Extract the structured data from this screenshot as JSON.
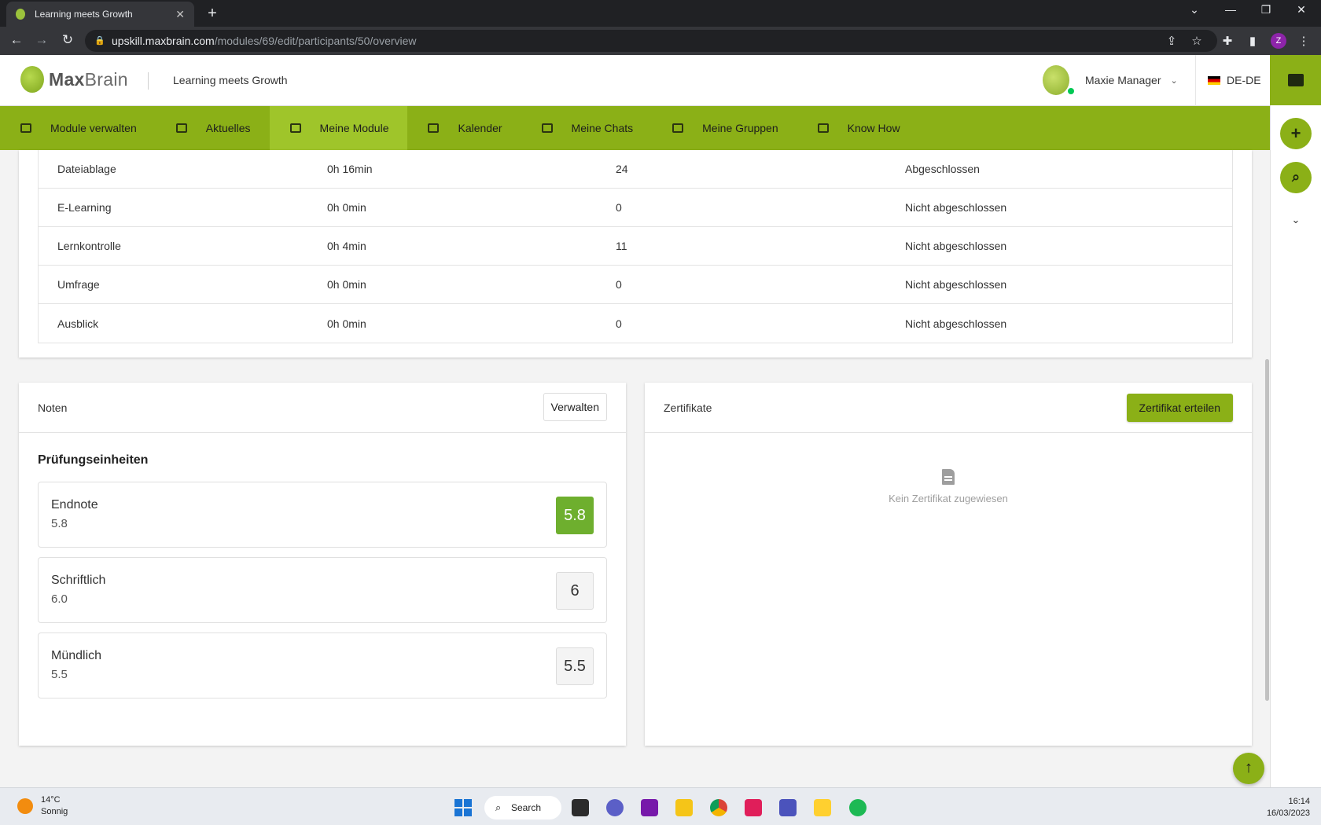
{
  "browser": {
    "tab_title": "Learning meets Growth",
    "url_host": "upskill.maxbrain.com",
    "url_path": "/modules/69/edit/participants/50/overview",
    "profile_initial": "Z"
  },
  "header": {
    "logo_text_bold": "Max",
    "logo_text_light": "Brain",
    "tagline": "Learning meets Growth",
    "user_name": "Maxie Manager",
    "language": "DE-DE"
  },
  "nav": {
    "items": [
      {
        "label": "Module verwalten",
        "icon": "module-admin-icon"
      },
      {
        "label": "Aktuelles",
        "icon": "news-icon"
      },
      {
        "label": "Meine Module",
        "icon": "graduation-cap-icon"
      },
      {
        "label": "Kalender",
        "icon": "calendar-icon"
      },
      {
        "label": "Meine Chats",
        "icon": "chat-icon"
      },
      {
        "label": "Meine Gruppen",
        "icon": "groups-icon"
      },
      {
        "label": "Know How",
        "icon": "book-icon"
      }
    ],
    "active": "Meine Module"
  },
  "progress_table": {
    "rows": [
      {
        "name": "Dateiablage",
        "time": "0h 16min",
        "count": "24",
        "status": "Abgeschlossen"
      },
      {
        "name": "E-Learning",
        "time": "0h 0min",
        "count": "0",
        "status": "Nicht abgeschlossen"
      },
      {
        "name": "Lernkontrolle",
        "time": "0h 4min",
        "count": "11",
        "status": "Nicht abgeschlossen"
      },
      {
        "name": "Umfrage",
        "time": "0h 0min",
        "count": "0",
        "status": "Nicht abgeschlossen"
      },
      {
        "name": "Ausblick",
        "time": "0h 0min",
        "count": "0",
        "status": "Nicht abgeschlossen"
      }
    ]
  },
  "notes": {
    "title": "Noten",
    "manage_label": "Verwalten",
    "subtitle": "Prüfungseinheiten",
    "grades": [
      {
        "name": "Endnote",
        "value": "5.8",
        "badge": "5.8"
      },
      {
        "name": "Schriftlich",
        "value": "6.0",
        "badge": "6"
      },
      {
        "name": "Mündlich",
        "value": "5.5",
        "badge": "5.5"
      }
    ]
  },
  "certificates": {
    "title": "Zertifikate",
    "issue_label": "Zertifikat erteilen",
    "empty_text": "Kein Zertifikat zugewiesen"
  },
  "taskbar": {
    "temperature": "14°C",
    "weather": "Sonnig",
    "search_label": "Search",
    "time": "16:14",
    "date": "16/03/2023"
  },
  "colors": {
    "brand_green": "#8bb017",
    "active_nav": "#9fc52a",
    "final_grade": "#6eaf2e"
  }
}
